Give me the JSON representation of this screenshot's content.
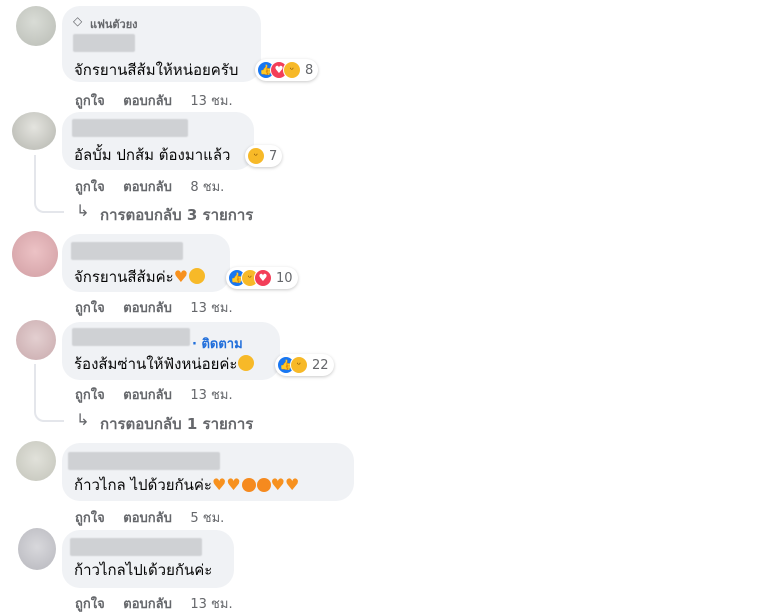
{
  "actions": {
    "like": "ถูกใจ",
    "reply": "ตอบกลับ"
  },
  "comments": [
    {
      "badge": "แฟนตัวยง",
      "text": "จักรยานสีส้มให้หน่อยครับ",
      "reactions": [
        "like",
        "love",
        "haha"
      ],
      "count": "8",
      "time": "13 ชม."
    },
    {
      "text": "อัลบั้ม ปกส้ม ต้องมาแล้ว",
      "reactions": [
        "haha"
      ],
      "count": "7",
      "time": "8 ชม.",
      "replies": "การตอบกลับ 3 รายการ"
    },
    {
      "text": "จักรยานสีส้มค่ะ",
      "emoji": [
        "orange-heart",
        "laughing-face"
      ],
      "reactions": [
        "like",
        "haha",
        "love"
      ],
      "count": "10",
      "time": "13 ชม."
    },
    {
      "follow": "· ติดตาม",
      "text": "ร้องส้มซ่านให้ฟังหน่อยค่ะ",
      "emoji": [
        "heart-eyes-face"
      ],
      "reactions": [
        "like",
        "haha"
      ],
      "count": "22",
      "time": "13 ชม.",
      "replies": "การตอบกลับ 1 รายการ"
    },
    {
      "text": "ก้าวไกล ไปด้วยกันค่ะ",
      "emoji": [
        "orange-heart",
        "orange-heart",
        "orange-fruit",
        "orange-fruit",
        "orange-heart",
        "orange-heart"
      ],
      "time": "5 ชม."
    },
    {
      "text": "ก้าวไกลไปเด้วยกันค่ะ",
      "time": "13 ชม."
    }
  ],
  "colors": {
    "like": "#1877f2",
    "love": "#f33e58",
    "haha": "#f7b928",
    "link": "#216fdb",
    "bubble": "#f0f2f5"
  }
}
